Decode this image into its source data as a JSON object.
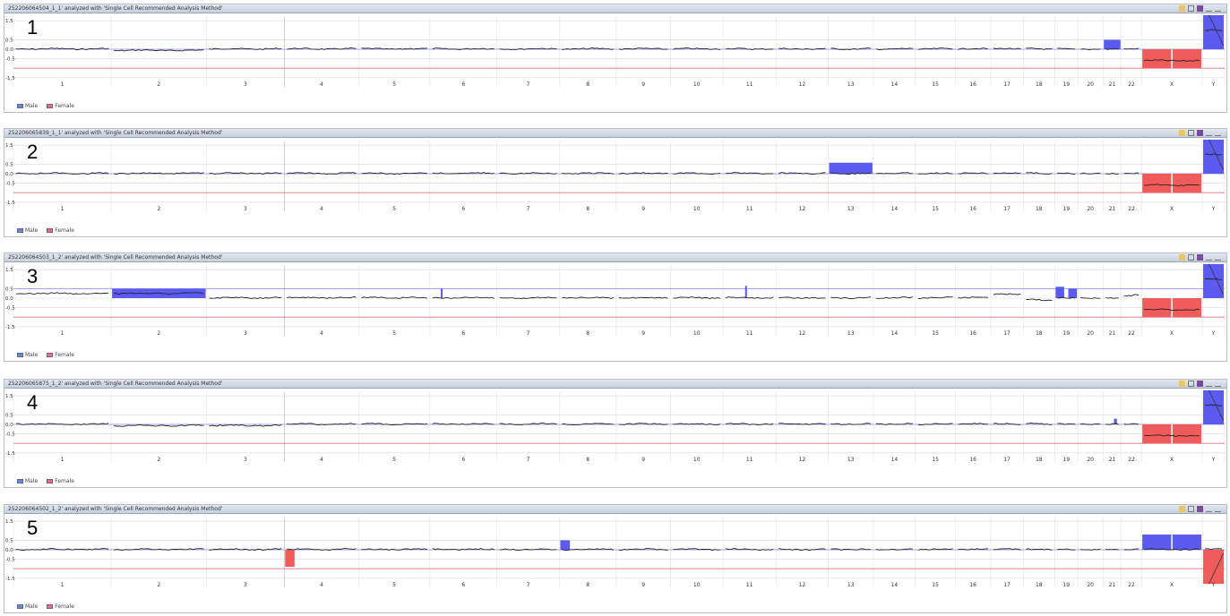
{
  "chromosomes": [
    "1",
    "2",
    "3",
    "4",
    "5",
    "6",
    "7",
    "8",
    "9",
    "10",
    "11",
    "12",
    "13",
    "14",
    "15",
    "16",
    "17",
    "18",
    "19",
    "20",
    "21",
    "22",
    "X",
    "Y"
  ],
  "chrom_sizes": [
    249,
    243,
    198,
    190,
    181,
    171,
    159,
    145,
    138,
    134,
    135,
    133,
    115,
    107,
    102,
    90,
    83,
    80,
    59,
    64,
    47,
    51,
    155,
    57
  ],
  "yticks": [
    "1.5",
    "0.5",
    "0.0",
    "-0.5",
    "-1.5"
  ],
  "ytick_values": [
    1.5,
    0.5,
    0.0,
    -0.5,
    -1.5
  ],
  "legend": {
    "male": "Male",
    "female": "Female"
  },
  "colors": {
    "gain": "#5b5bf0",
    "loss": "#f05b5b",
    "male_line": "#8c8cf0",
    "female_line": "#e0707a",
    "trace": "#222222"
  },
  "icons": [
    "lock-icon",
    "table-icon",
    "chart-icon",
    "pin-icon",
    "close-icon"
  ],
  "chart_data": [
    {
      "type": "line",
      "panel_label": "1",
      "title": "252206064504_1_1' analyzed with 'Single Cell Recommended Analysis Method'",
      "ylim": [
        -1.7,
        1.7
      ],
      "reference_lines": {
        "male": 0.0,
        "female": -1.0
      },
      "baseline": [
        0.02,
        -0.06,
        0.02,
        0.02,
        0.02,
        0.02,
        0.02,
        0.02,
        0.02,
        0.02,
        0.02,
        0.02,
        0.02,
        0.02,
        0.02,
        0.02,
        0.02,
        0.02,
        0.02,
        0.02,
        0.02,
        0.02,
        -0.6,
        1.0
      ],
      "segments": [
        {
          "chrom": "21",
          "start": 0.0,
          "end": 1.0,
          "value": 0.5
        },
        {
          "chrom": "X",
          "start": 0.0,
          "end": 1.0,
          "value": -1.0
        },
        {
          "chrom": "Y",
          "start": 0.0,
          "end": 1.0,
          "value": 1.8
        }
      ]
    },
    {
      "type": "line",
      "panel_label": "2",
      "title": "252206065839_1_1' analyzed with 'Single Cell Recommended Analysis Method'",
      "ylim": [
        -1.7,
        1.7
      ],
      "reference_lines": {
        "male": 0.0,
        "female": -1.0
      },
      "baseline": [
        0.02,
        0.02,
        0.02,
        0.02,
        0.02,
        0.02,
        0.02,
        0.02,
        0.02,
        0.02,
        0.02,
        0.02,
        0.02,
        0.02,
        0.02,
        0.02,
        0.02,
        0.02,
        0.02,
        0.02,
        0.02,
        0.02,
        -0.6,
        1.0
      ],
      "segments": [
        {
          "chrom": "13",
          "start": 0.0,
          "end": 1.0,
          "value": 0.58
        },
        {
          "chrom": "X",
          "start": 0.0,
          "end": 1.0,
          "value": -1.0
        },
        {
          "chrom": "Y",
          "start": 0.0,
          "end": 1.0,
          "value": 1.8
        }
      ]
    },
    {
      "type": "line",
      "panel_label": "3",
      "title": "252206064503_1_2' analyzed with 'Single Cell Recommended Analysis Method'",
      "ylim": [
        -1.7,
        1.7
      ],
      "reference_lines": {
        "male": 0.5,
        "female": -1.0
      },
      "baseline": [
        0.25,
        0.25,
        0.02,
        0.02,
        0.02,
        0.02,
        0.02,
        0.02,
        0.02,
        0.02,
        0.02,
        0.02,
        0.02,
        0.02,
        0.02,
        0.02,
        0.2,
        -0.1,
        0.02,
        0.02,
        0.02,
        0.15,
        -0.6,
        1.0
      ],
      "segments": [
        {
          "chrom": "2",
          "start": 0.0,
          "end": 1.0,
          "value": 0.5
        },
        {
          "chrom": "6",
          "start": 0.15,
          "end": 0.2,
          "value": 0.5
        },
        {
          "chrom": "11",
          "start": 0.4,
          "end": 0.45,
          "value": 0.65
        },
        {
          "chrom": "19",
          "start": 0.0,
          "end": 0.45,
          "value": 0.6
        },
        {
          "chrom": "19",
          "start": 0.55,
          "end": 1.0,
          "value": 0.5
        },
        {
          "chrom": "X",
          "start": 0.0,
          "end": 1.0,
          "value": -1.0
        },
        {
          "chrom": "Y",
          "start": 0.0,
          "end": 1.0,
          "value": 1.8
        }
      ]
    },
    {
      "type": "line",
      "panel_label": "4",
      "title": "252206065875_1_2' analyzed with 'Single Cell Recommended Analysis Method'",
      "ylim": [
        -1.7,
        1.7
      ],
      "reference_lines": {
        "male": 0.0,
        "female": -1.0
      },
      "baseline": [
        0.02,
        -0.06,
        -0.06,
        0.02,
        0.02,
        0.02,
        0.02,
        0.02,
        0.02,
        0.02,
        0.02,
        0.02,
        0.02,
        0.02,
        0.02,
        0.02,
        0.02,
        0.02,
        0.02,
        0.02,
        0.02,
        0.02,
        -0.6,
        1.0
      ],
      "segments": [
        {
          "chrom": "21",
          "start": 0.55,
          "end": 0.8,
          "value": 0.3
        },
        {
          "chrom": "X",
          "start": 0.0,
          "end": 1.0,
          "value": -1.0
        },
        {
          "chrom": "Y",
          "start": 0.0,
          "end": 1.0,
          "value": 1.8
        }
      ]
    },
    {
      "type": "line",
      "panel_label": "5",
      "title": "252206064502_1_2' analyzed with 'Single Cell Recommended Analysis Method'",
      "ylim": [
        -1.7,
        1.7
      ],
      "reference_lines": {
        "male": 0.0,
        "female": -1.0
      },
      "baseline": [
        0.02,
        0.02,
        0.02,
        0.02,
        0.02,
        0.02,
        0.02,
        0.02,
        0.02,
        0.02,
        0.02,
        0.02,
        0.02,
        0.02,
        0.02,
        0.02,
        0.02,
        0.02,
        0.02,
        0.02,
        0.02,
        0.02,
        0.02,
        0.02
      ],
      "segments": [
        {
          "chrom": "4",
          "start": 0.0,
          "end": 0.15,
          "value": -0.9
        },
        {
          "chrom": "8",
          "start": 0.0,
          "end": 0.2,
          "value": 0.5
        },
        {
          "chrom": "X",
          "start": 0.0,
          "end": 1.0,
          "value": 0.8
        },
        {
          "chrom": "Y",
          "start": 0.0,
          "end": 1.0,
          "value": -1.8
        }
      ]
    }
  ]
}
